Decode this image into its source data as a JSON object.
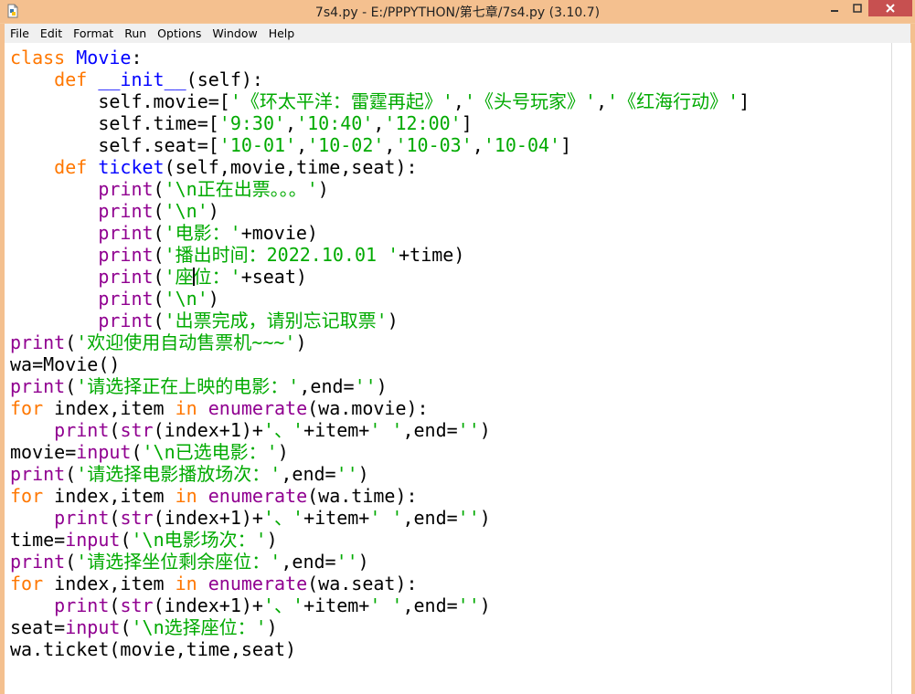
{
  "window": {
    "title": "7s4.py - E:/PPPYTHON/第七章/7s4.py (3.10.7)",
    "icon": "python-file-icon",
    "controls": {
      "minimize": "–",
      "maximize": "□",
      "close": "✕"
    },
    "colors": {
      "frame": "#f4c08f",
      "close": "#c75050"
    }
  },
  "menu": [
    "File",
    "Edit",
    "Format",
    "Run",
    "Options",
    "Window",
    "Help"
  ],
  "editor": {
    "colors": {
      "keyword": "#ff7700",
      "builtin": "#900090",
      "definition": "#0000ff",
      "string": "#00aa00"
    },
    "lines": [
      [
        [
          "kw",
          "class"
        ],
        [
          "t",
          " "
        ],
        [
          "def",
          "Movie"
        ],
        [
          "t",
          ":"
        ]
      ],
      [
        [
          "t",
          "    "
        ],
        [
          "kw",
          "def"
        ],
        [
          "t",
          " "
        ],
        [
          "def",
          "__init__"
        ],
        [
          "t",
          "(self):"
        ]
      ],
      [
        [
          "t",
          "        self.movie=["
        ],
        [
          "str",
          "'《环太平洋：雷霆再起》'"
        ],
        [
          "t",
          ","
        ],
        [
          "str",
          "'《头号玩家》'"
        ],
        [
          "t",
          ","
        ],
        [
          "str",
          "'《红海行动》'"
        ],
        [
          "t",
          "]"
        ]
      ],
      [
        [
          "t",
          "        self.time=["
        ],
        [
          "str",
          "'9:30'"
        ],
        [
          "t",
          ","
        ],
        [
          "str",
          "'10:40'"
        ],
        [
          "t",
          ","
        ],
        [
          "str",
          "'12:00'"
        ],
        [
          "t",
          "]"
        ]
      ],
      [
        [
          "t",
          "        self.seat=["
        ],
        [
          "str",
          "'10-01'"
        ],
        [
          "t",
          ","
        ],
        [
          "str",
          "'10-02'"
        ],
        [
          "t",
          ","
        ],
        [
          "str",
          "'10-03'"
        ],
        [
          "t",
          ","
        ],
        [
          "str",
          "'10-04'"
        ],
        [
          "t",
          "]"
        ]
      ],
      [
        [
          "t",
          "    "
        ],
        [
          "kw",
          "def"
        ],
        [
          "t",
          " "
        ],
        [
          "def",
          "ticket"
        ],
        [
          "t",
          "(self,movie,time,seat):"
        ]
      ],
      [
        [
          "t",
          "        "
        ],
        [
          "bi",
          "print"
        ],
        [
          "t",
          "("
        ],
        [
          "str",
          "'\\n正在出票。。。'"
        ],
        [
          "t",
          ")"
        ]
      ],
      [
        [
          "t",
          "        "
        ],
        [
          "bi",
          "print"
        ],
        [
          "t",
          "("
        ],
        [
          "str",
          "'\\n'"
        ],
        [
          "t",
          ")"
        ]
      ],
      [
        [
          "t",
          "        "
        ],
        [
          "bi",
          "print"
        ],
        [
          "t",
          "("
        ],
        [
          "str",
          "'电影：'"
        ],
        [
          "t",
          "+movie)"
        ]
      ],
      [
        [
          "t",
          "        "
        ],
        [
          "bi",
          "print"
        ],
        [
          "t",
          "("
        ],
        [
          "str",
          "'播出时间：2022.10.01 '"
        ],
        [
          "t",
          "+time)"
        ]
      ],
      [
        [
          "t",
          "        "
        ],
        [
          "bi",
          "print"
        ],
        [
          "t",
          "("
        ],
        [
          "str",
          "'座"
        ],
        [
          "caret",
          ""
        ],
        [
          "str",
          "位：'"
        ],
        [
          "t",
          "+seat)"
        ]
      ],
      [
        [
          "t",
          "        "
        ],
        [
          "bi",
          "print"
        ],
        [
          "t",
          "("
        ],
        [
          "str",
          "'\\n'"
        ],
        [
          "t",
          ")"
        ]
      ],
      [
        [
          "t",
          "        "
        ],
        [
          "bi",
          "print"
        ],
        [
          "t",
          "("
        ],
        [
          "str",
          "'出票完成，请别忘记取票'"
        ],
        [
          "t",
          ")"
        ]
      ],
      [
        [
          "bi",
          "print"
        ],
        [
          "t",
          "("
        ],
        [
          "str",
          "'欢迎使用自动售票机~~~'"
        ],
        [
          "t",
          ")"
        ]
      ],
      [
        [
          "t",
          "wa=Movie()"
        ]
      ],
      [
        [
          "bi",
          "print"
        ],
        [
          "t",
          "("
        ],
        [
          "str",
          "'请选择正在上映的电影：'"
        ],
        [
          "t",
          ",end="
        ],
        [
          "str",
          "''"
        ],
        [
          "t",
          ")"
        ]
      ],
      [
        [
          "kw",
          "for"
        ],
        [
          "t",
          " index,item "
        ],
        [
          "kw",
          "in"
        ],
        [
          "t",
          " "
        ],
        [
          "bi",
          "enumerate"
        ],
        [
          "t",
          "(wa.movie):"
        ]
      ],
      [
        [
          "t",
          "    "
        ],
        [
          "bi",
          "print"
        ],
        [
          "t",
          "("
        ],
        [
          "bi",
          "str"
        ],
        [
          "t",
          "(index+1)+"
        ],
        [
          "str",
          "'、'"
        ],
        [
          "t",
          "+item+"
        ],
        [
          "str",
          "' '"
        ],
        [
          "t",
          ",end="
        ],
        [
          "str",
          "''"
        ],
        [
          "t",
          ")"
        ]
      ],
      [
        [
          "t",
          "movie="
        ],
        [
          "bi",
          "input"
        ],
        [
          "t",
          "("
        ],
        [
          "str",
          "'\\n已选电影：'"
        ],
        [
          "t",
          ")"
        ]
      ],
      [
        [
          "bi",
          "print"
        ],
        [
          "t",
          "("
        ],
        [
          "str",
          "'请选择电影播放场次：'"
        ],
        [
          "t",
          ",end="
        ],
        [
          "str",
          "''"
        ],
        [
          "t",
          ")"
        ]
      ],
      [
        [
          "kw",
          "for"
        ],
        [
          "t",
          " index,item "
        ],
        [
          "kw",
          "in"
        ],
        [
          "t",
          " "
        ],
        [
          "bi",
          "enumerate"
        ],
        [
          "t",
          "(wa.time):"
        ]
      ],
      [
        [
          "t",
          "    "
        ],
        [
          "bi",
          "print"
        ],
        [
          "t",
          "("
        ],
        [
          "bi",
          "str"
        ],
        [
          "t",
          "(index+1)+"
        ],
        [
          "str",
          "'、'"
        ],
        [
          "t",
          "+item+"
        ],
        [
          "str",
          "' '"
        ],
        [
          "t",
          ",end="
        ],
        [
          "str",
          "''"
        ],
        [
          "t",
          ")"
        ]
      ],
      [
        [
          "t",
          "time="
        ],
        [
          "bi",
          "input"
        ],
        [
          "t",
          "("
        ],
        [
          "str",
          "'\\n电影场次：'"
        ],
        [
          "t",
          ")"
        ]
      ],
      [
        [
          "bi",
          "print"
        ],
        [
          "t",
          "("
        ],
        [
          "str",
          "'请选择坐位剩余座位：'"
        ],
        [
          "t",
          ",end="
        ],
        [
          "str",
          "''"
        ],
        [
          "t",
          ")"
        ]
      ],
      [
        [
          "kw",
          "for"
        ],
        [
          "t",
          " index,item "
        ],
        [
          "kw",
          "in"
        ],
        [
          "t",
          " "
        ],
        [
          "bi",
          "enumerate"
        ],
        [
          "t",
          "(wa.seat):"
        ]
      ],
      [
        [
          "t",
          "    "
        ],
        [
          "bi",
          "print"
        ],
        [
          "t",
          "("
        ],
        [
          "bi",
          "str"
        ],
        [
          "t",
          "(index+1)+"
        ],
        [
          "str",
          "'、'"
        ],
        [
          "t",
          "+item+"
        ],
        [
          "str",
          "' '"
        ],
        [
          "t",
          ",end="
        ],
        [
          "str",
          "''"
        ],
        [
          "t",
          ")"
        ]
      ],
      [
        [
          "t",
          "seat="
        ],
        [
          "bi",
          "input"
        ],
        [
          "t",
          "("
        ],
        [
          "str",
          "'\\n选择座位：'"
        ],
        [
          "t",
          ")"
        ]
      ],
      [
        [
          "t",
          "wa.ticket(movie,time,seat)"
        ]
      ]
    ]
  }
}
